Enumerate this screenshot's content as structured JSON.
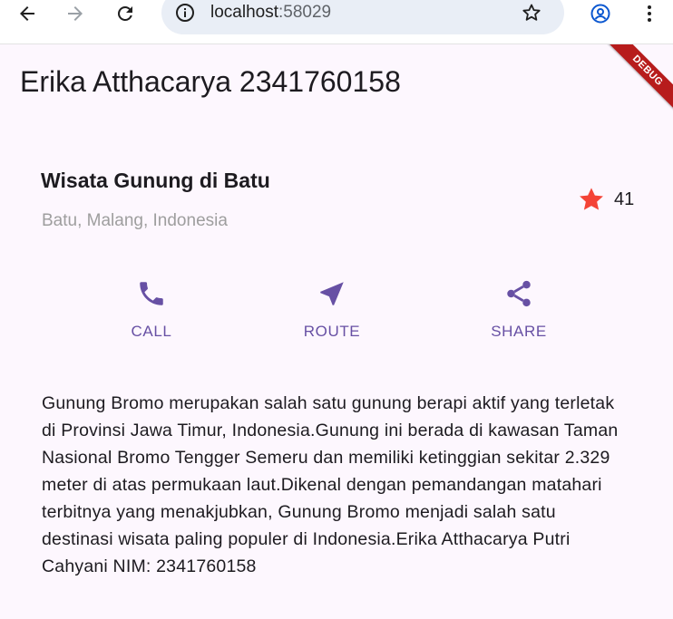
{
  "browser": {
    "url_host": "localhost",
    "url_port": ":58029"
  },
  "debug_banner": "DEBUG",
  "app": {
    "title": "Erika Atthacarya 2341760158",
    "place": {
      "name": "Wisata Gunung di Batu",
      "location": "Batu, Malang, Indonesia",
      "rating_count": "41"
    },
    "actions": [
      {
        "label": "CALL",
        "icon": "phone-icon"
      },
      {
        "label": "ROUTE",
        "icon": "navigation-arrow-icon"
      },
      {
        "label": "SHARE",
        "icon": "share-icon"
      }
    ],
    "description": "Gunung Bromo merupakan salah satu gunung berapi aktif yang terletak di Provinsi Jawa Timur, Indonesia.Gunung ini berada di kawasan Taman Nasional Bromo Tengger Semeru dan memiliki ketinggian sekitar 2.329 meter di atas permukaan laut.Dikenal dengan pemandangan matahari terbitnya yang menakjubkan, Gunung Bromo menjadi salah satu destinasi wisata paling populer di Indonesia.Erika Atthacarya Putri Cahyani NIM: 2341760158"
  },
  "colors": {
    "accent": "#6750a4",
    "star": "#f44336",
    "background": "#fdf7fe",
    "debug_banner": "#b71c1c"
  }
}
